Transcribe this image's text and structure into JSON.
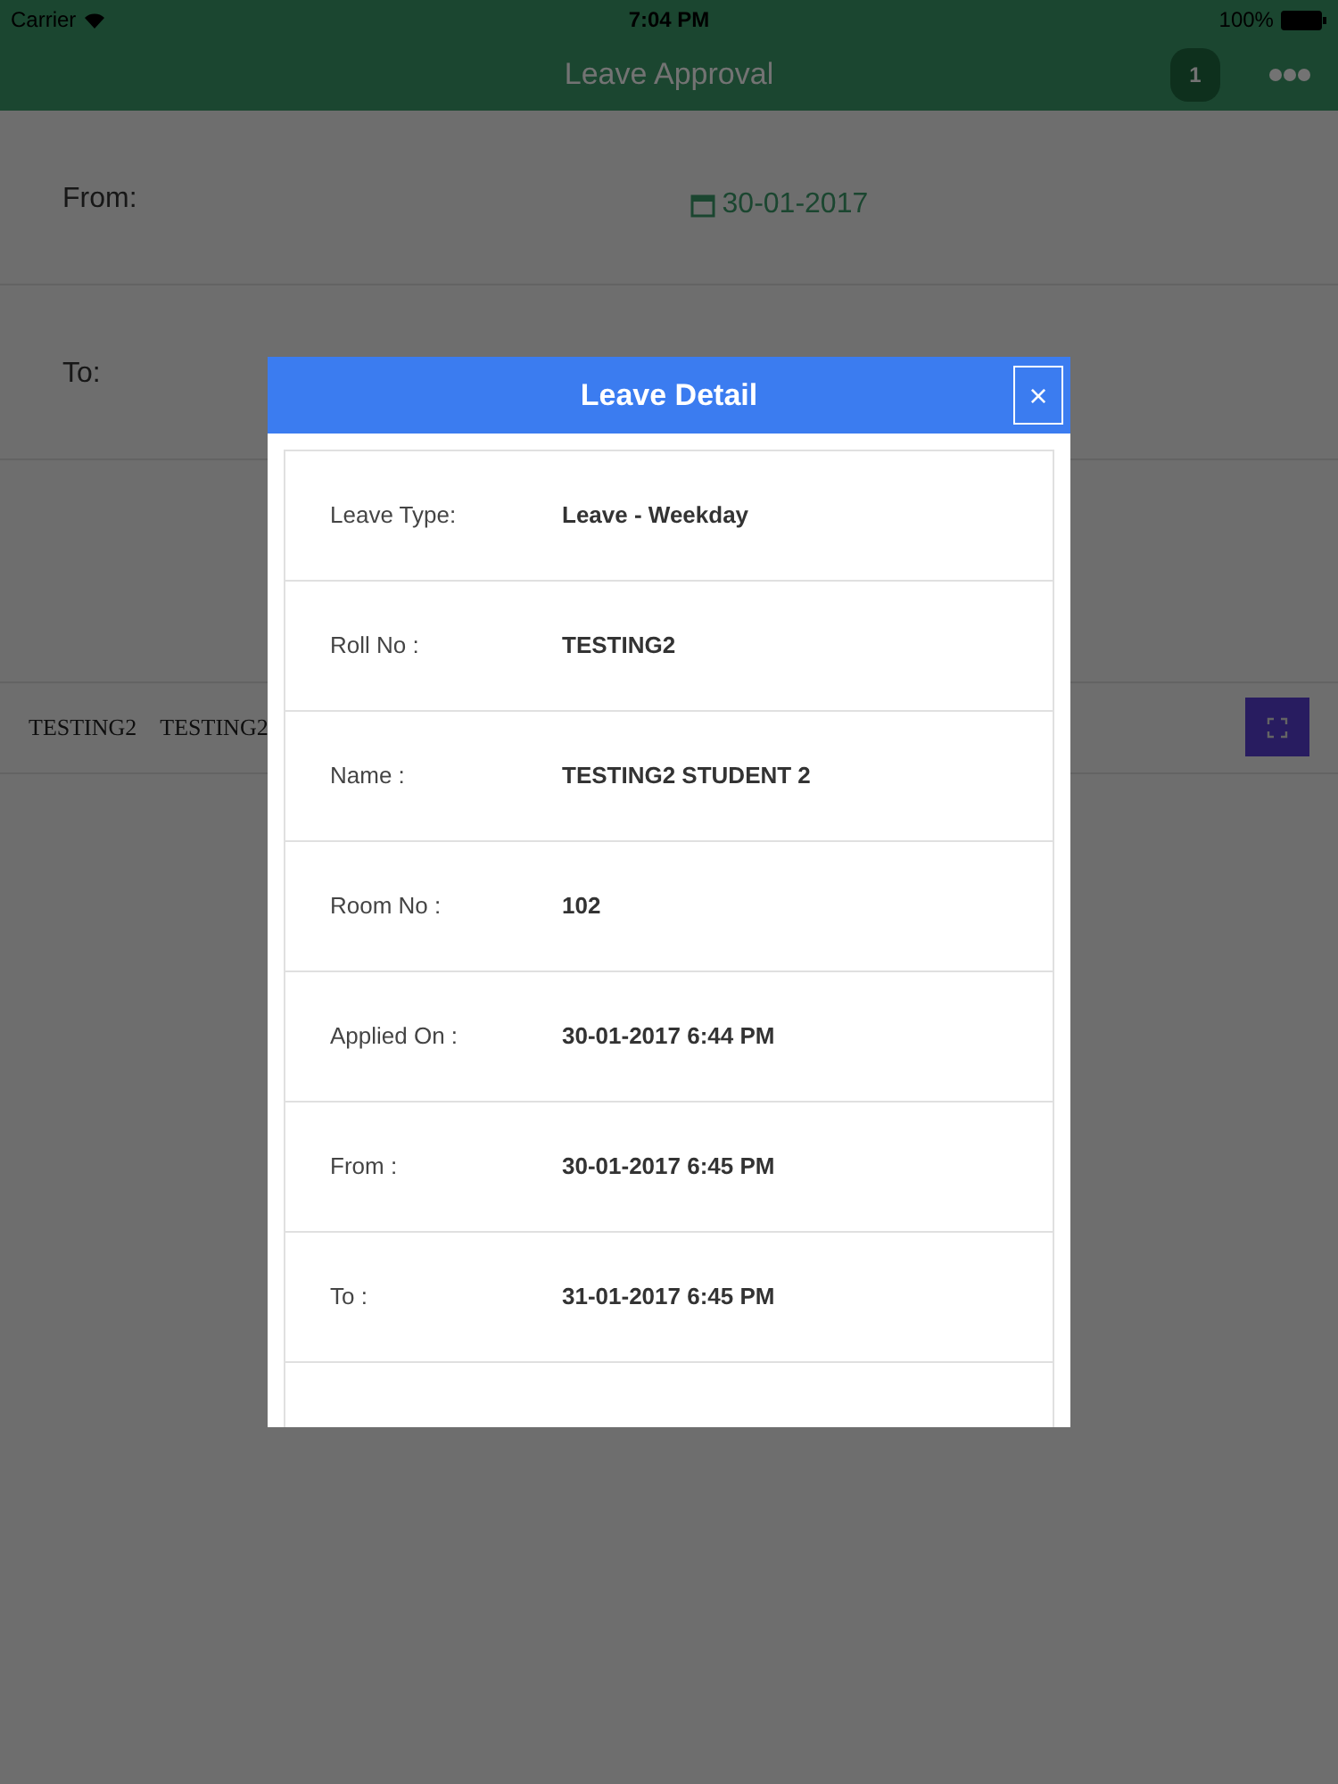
{
  "status_bar": {
    "carrier": "Carrier",
    "time": "7:04 PM",
    "battery": "100%"
  },
  "nav": {
    "title": "Leave Approval",
    "badge": "1"
  },
  "filters": [
    {
      "label": "From:",
      "value": "30-01-2017"
    },
    {
      "label": "To:"
    }
  ],
  "list_row": {
    "cells": [
      "TESTING2",
      "TESTING2"
    ]
  },
  "modal": {
    "title": "Leave Detail",
    "close": "×",
    "rows": [
      {
        "label": "Leave Type:",
        "value": "Leave - Weekday"
      },
      {
        "label": "Roll No :",
        "value": "TESTING2"
      },
      {
        "label": "Name :",
        "value": "TESTING2 STUDENT 2"
      },
      {
        "label": "Room No :",
        "value": "102"
      },
      {
        "label": "Applied On :",
        "value": "30-01-2017 6:44 PM"
      },
      {
        "label": "From :",
        "value": "30-01-2017 6:45 PM"
      },
      {
        "label": "To :",
        "value": "31-01-2017 6:45 PM"
      }
    ]
  }
}
